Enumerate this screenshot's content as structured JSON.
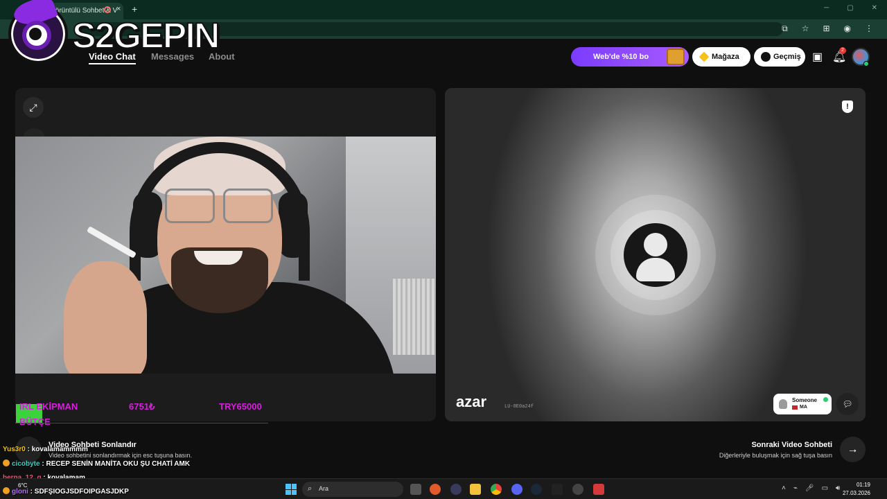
{
  "browser": {
    "tab_title": "Görüntülü Sohbet & V",
    "close_glyph": "×",
    "new_tab_glyph": "+"
  },
  "overlay_logo": {
    "text": "S2GEPIN"
  },
  "nav": {
    "links": [
      "Video Chat",
      "Messages",
      "About"
    ],
    "active": "Video Chat",
    "promo_label": "Web'de %10 bo",
    "store_label": "Mağaza",
    "history_label": "Geçmiş",
    "notification_count": "2"
  },
  "hud": {
    "row1": {
      "label": "IRL EKİPMAN",
      "amount": "6751₺",
      "target": "TRY65000"
    },
    "row2": {
      "label": "BÜTÇE"
    }
  },
  "stranger": {
    "watermark": "azar",
    "session_id": "LU-8E0a24f",
    "name": "Someone",
    "country": "MA"
  },
  "actions": {
    "end_title": "Video Sohbeti Sonlandır",
    "end_subtitle": "Video sohbetini sonlandırmak için esc tuşuna basın.",
    "next_title": "Sonraki Video Sohbeti",
    "next_subtitle": "Diğerleriyle buluşmak için sağ tuşa basın",
    "next_glyph": "→"
  },
  "chat": [
    {
      "user": "Yus3r0",
      "message": "kovalamammmm"
    },
    {
      "user": "cicobyte",
      "message": "RECEP SENİN MANİTA OKU ŞU CHATİ AMK"
    },
    {
      "user": "berna_12_g",
      "message": "kovalamam"
    },
    {
      "user": "gloni",
      "message": "SDFŞIOGJSDFOIPGASJDKP"
    }
  ],
  "taskbar": {
    "weather": "6°C",
    "search_placeholder": "Ara",
    "time": "01:19",
    "date": "27.03.2026"
  },
  "colors": {
    "accent_purple": "#7b3cff",
    "hud_magenta": "#d91ee0",
    "hud_green": "#3cd23c",
    "online_green": "#2ecc71"
  },
  "icons": [
    "expand-icon",
    "magic-wand-icon",
    "smiley-icon",
    "shield-icon",
    "chat-bubble-icon",
    "bell-icon",
    "store-box-icon",
    "gem-icon",
    "clock-icon",
    "arrow-right-icon",
    "windows-start-icon",
    "search-icon"
  ]
}
